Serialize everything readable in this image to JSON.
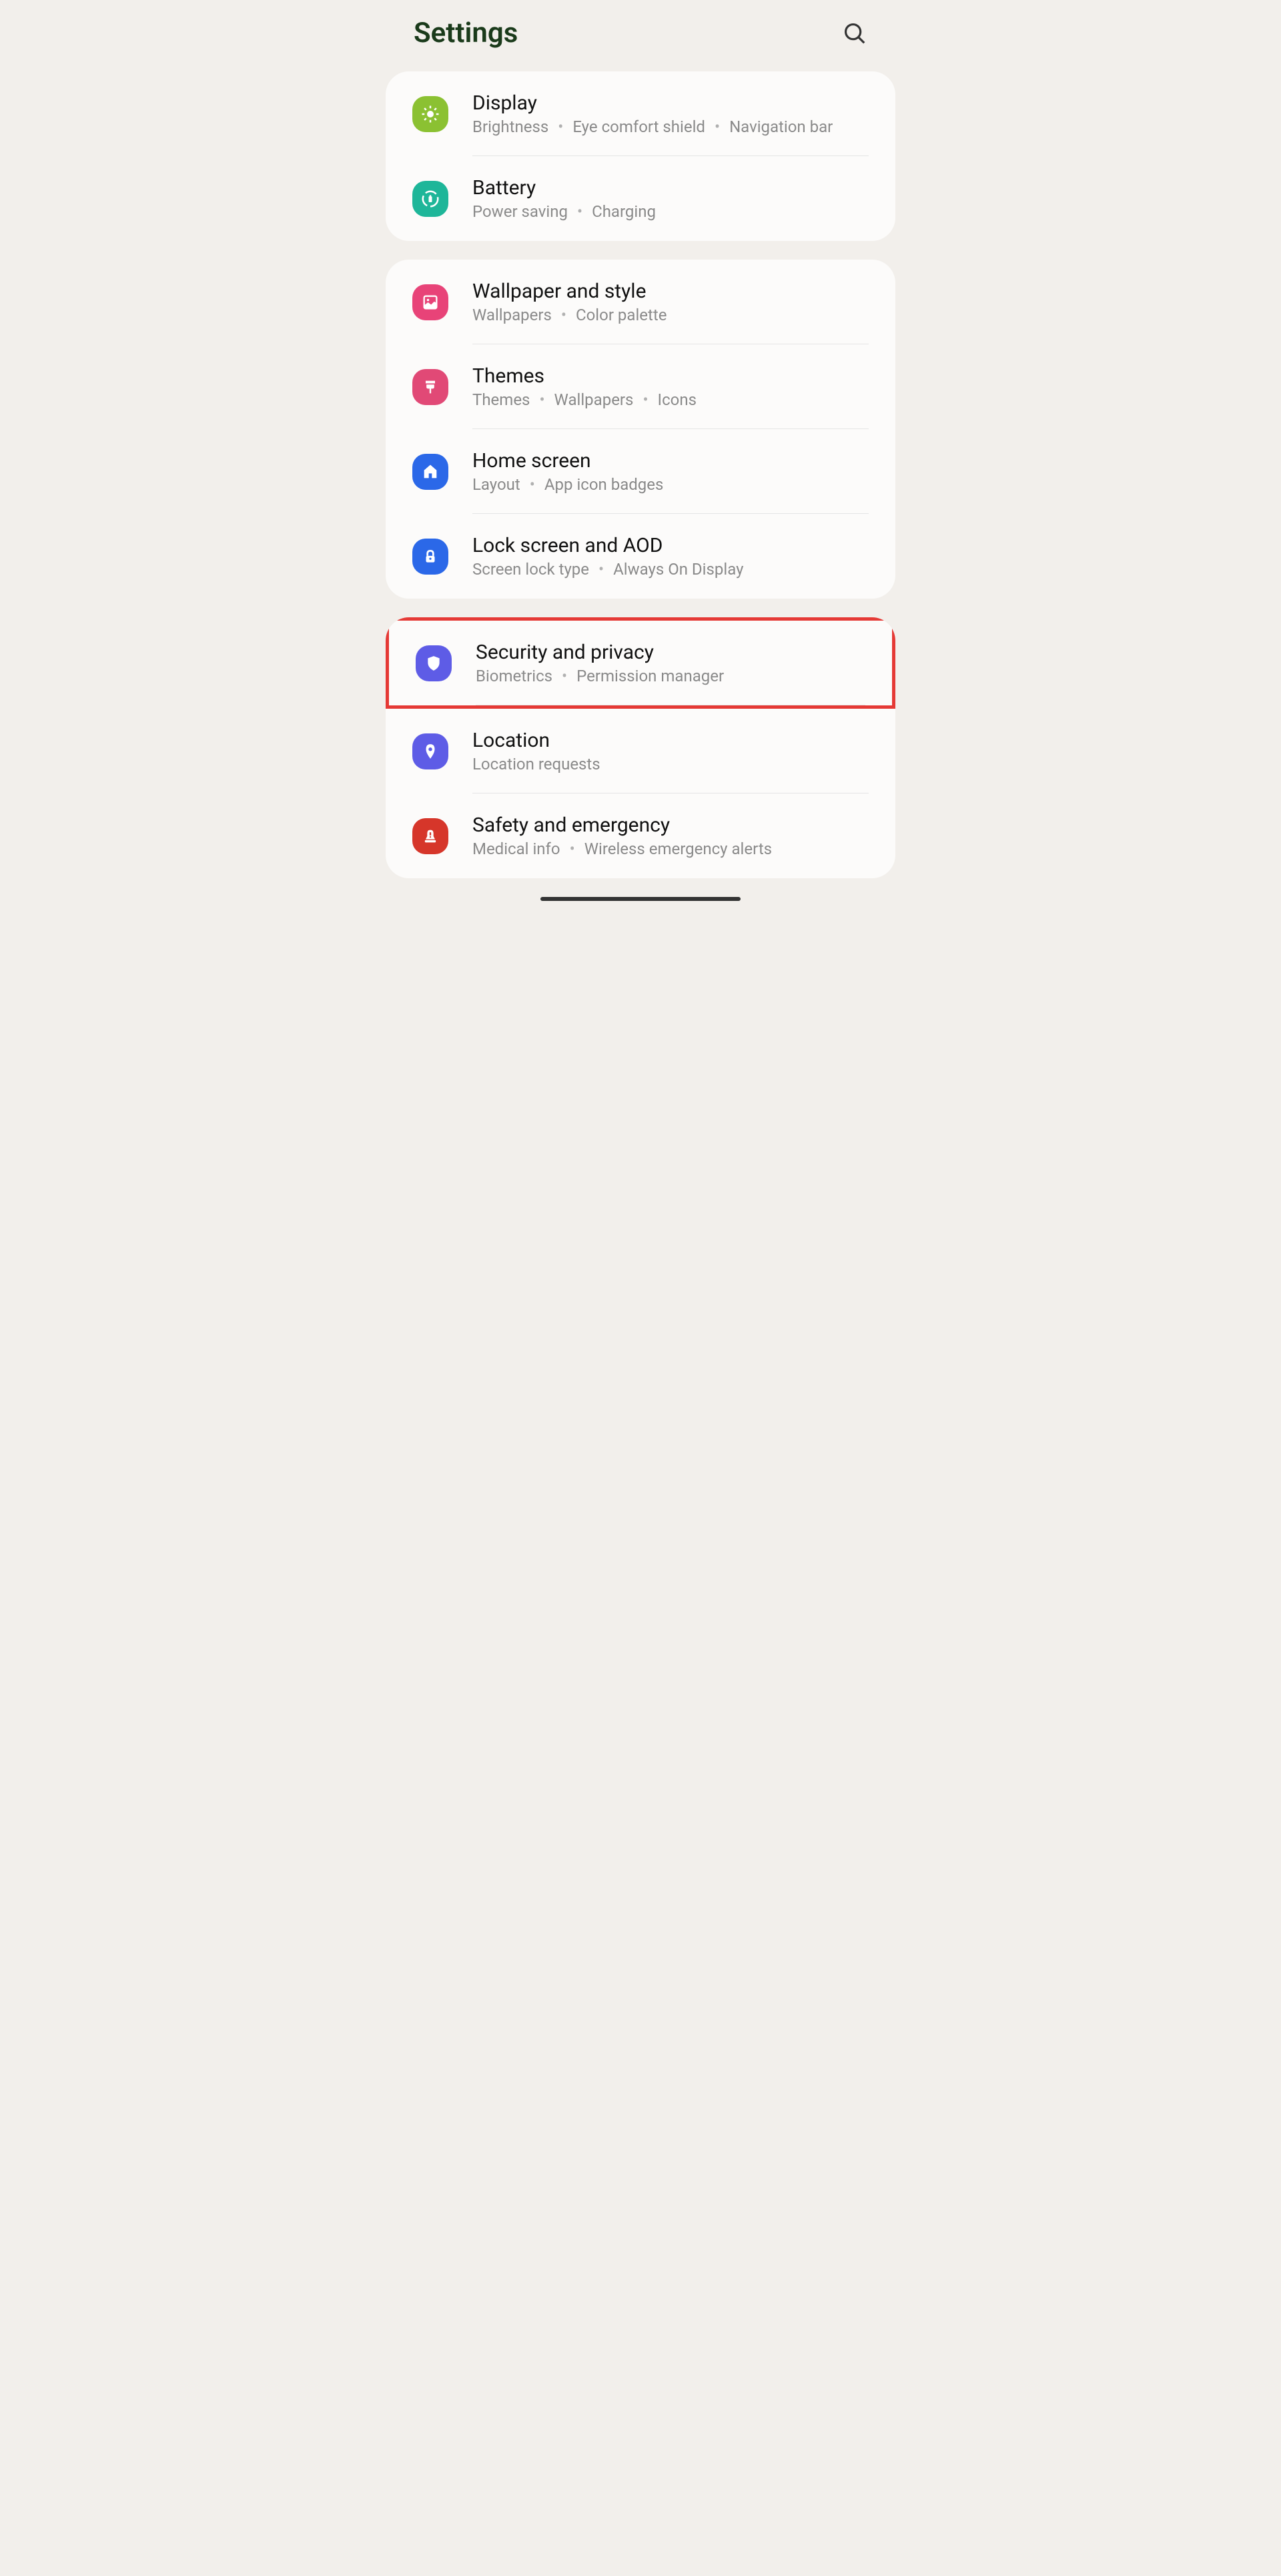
{
  "header": {
    "title": "Settings"
  },
  "groups": [
    {
      "items": [
        {
          "key": "display",
          "title": "Display",
          "subtitle": [
            "Brightness",
            "Eye comfort shield",
            "Navigation bar"
          ],
          "iconColor": "#8bc132"
        },
        {
          "key": "battery",
          "title": "Battery",
          "subtitle": [
            "Power saving",
            "Charging"
          ],
          "iconColor": "#1eb699"
        }
      ]
    },
    {
      "items": [
        {
          "key": "wallpaper",
          "title": "Wallpaper and style",
          "subtitle": [
            "Wallpapers",
            "Color palette"
          ],
          "iconColor": "#e84378"
        },
        {
          "key": "themes",
          "title": "Themes",
          "subtitle": [
            "Themes",
            "Wallpapers",
            "Icons"
          ],
          "iconColor": "#e14976"
        },
        {
          "key": "home-screen",
          "title": "Home screen",
          "subtitle": [
            "Layout",
            "App icon badges"
          ],
          "iconColor": "#2b68e8"
        },
        {
          "key": "lock-screen",
          "title": "Lock screen and AOD",
          "subtitle": [
            "Screen lock type",
            "Always On Display"
          ],
          "iconColor": "#2b68e8"
        }
      ]
    },
    {
      "items": [
        {
          "key": "security",
          "title": "Security and privacy",
          "subtitle": [
            "Biometrics",
            "Permission manager"
          ],
          "iconColor": "#5e5ce6",
          "highlighted": true
        },
        {
          "key": "location",
          "title": "Location",
          "subtitle": [
            "Location requests"
          ],
          "iconColor": "#5e5ce6"
        },
        {
          "key": "safety",
          "title": "Safety and emergency",
          "subtitle": [
            "Medical info",
            "Wireless emergency alerts"
          ],
          "iconColor": "#d6362a"
        }
      ]
    }
  ]
}
